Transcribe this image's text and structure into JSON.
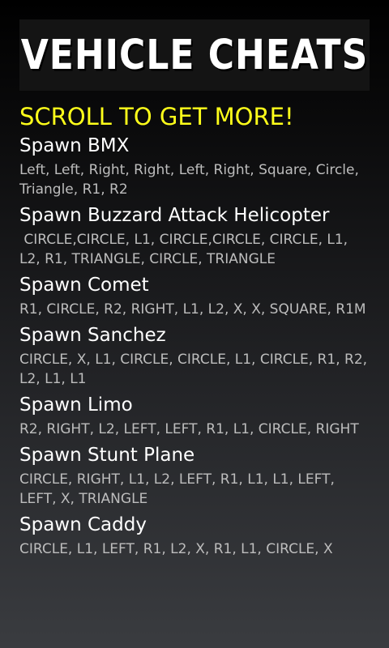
{
  "header": {
    "title": "VEHICLE CHEATS"
  },
  "scroll_hint": "SCROLL TO GET MORE!",
  "cheats": [
    {
      "name": "Spawn BMX",
      "code": "Left, Left, Right, Right, Left, Right, Square, Circle, Triangle, R1, R2"
    },
    {
      "name": "Spawn Buzzard Attack Helicopter",
      "code": " CIRCLE,CIRCLE, L1, CIRCLE,CIRCLE, CIRCLE, L1, L2, R1, TRIANGLE, CIRCLE, TRIANGLE"
    },
    {
      "name": "Spawn Comet",
      "code": "R1, CIRCLE, R2, RIGHT, L1, L2, X, X, SQUARE, R1M"
    },
    {
      "name": "Spawn Sanchez",
      "code": "CIRCLE, X, L1, CIRCLE, CIRCLE, L1, CIRCLE, R1, R2, L2, L1, L1"
    },
    {
      "name": "Spawn Limo",
      "code": "R2, RIGHT, L2, LEFT, LEFT, R1, L1, CIRCLE, RIGHT"
    },
    {
      "name": "Spawn Stunt Plane",
      "code": "CIRCLE, RIGHT, L1, L2, LEFT, R1, L1, L1, LEFT, LEFT, X, TRIANGLE"
    },
    {
      "name": "Spawn Caddy",
      "code": "CIRCLE, L1, LEFT, R1, L2, X, R1, L1, CIRCLE, X"
    }
  ]
}
